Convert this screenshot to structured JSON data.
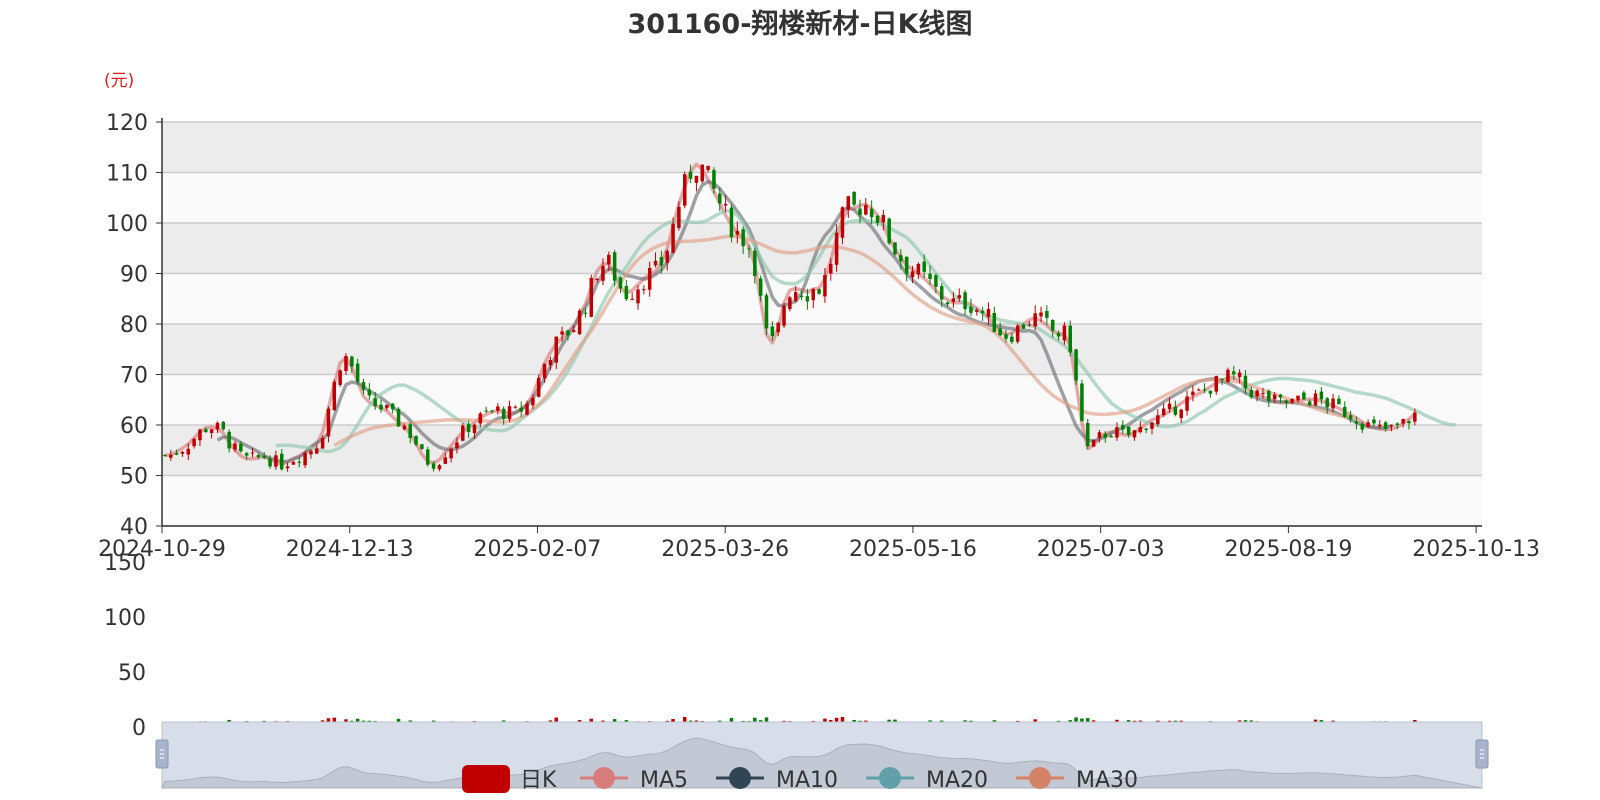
{
  "chart_data": {
    "type": "candlestick",
    "title": "301160-翔楼新材-日K线图",
    "unit_label": "(元)",
    "colors": {
      "up": "#c00000",
      "down": "#008000",
      "ma5": "#d87c7c",
      "ma10": "#6e7074",
      "ma20": "#91c7ae",
      "ma30": "#e0a088",
      "title": "#333333",
      "unit": "#e02020"
    },
    "price_axis": {
      "min": 40,
      "max": 120,
      "ticks": [
        40,
        50,
        60,
        70,
        80,
        90,
        100,
        110,
        120
      ]
    },
    "volume_axis": {
      "min": 0,
      "max": 150,
      "ticks": [
        0,
        50,
        100,
        150
      ]
    },
    "x_tick_labels": [
      {
        "index": 0,
        "label": "2024-10-29"
      },
      {
        "index": 32,
        "label": "2024-12-13"
      },
      {
        "index": 64,
        "label": "2025-02-07"
      },
      {
        "index": 96,
        "label": "2025-03-26"
      },
      {
        "index": 128,
        "label": "2025-05-16"
      },
      {
        "index": 160,
        "label": "2025-07-03"
      },
      {
        "index": 192,
        "label": "2025-08-19"
      },
      {
        "index": 224,
        "label": "2025-10-13"
      }
    ],
    "legend": [
      "日K",
      "MA5",
      "MA10",
      "MA20",
      "MA30"
    ],
    "series": [
      {
        "name": "MA5",
        "color": "#d87c7c",
        "values": [
          54.0,
          54.1,
          54.7,
          55.4,
          56.2,
          57.4,
          58.6,
          59.4,
          59.6,
          59.3,
          58.4,
          56.5,
          55.1,
          53.9,
          53.3,
          53.3,
          53.5,
          53.8,
          53.1,
          52.7,
          52.2,
          52.7,
          53.4,
          53.8,
          54.5,
          55.3,
          56.3,
          58.6,
          63.4,
          68.1,
          72.3,
          73.3,
          71.5,
          68.6,
          65.7,
          64.5,
          63.9,
          63.4,
          62.8,
          61.6,
          60.6,
          59.8,
          58.2,
          56.4,
          54.2,
          52.8,
          52.5,
          53.1,
          54.6,
          55.9,
          57.3,
          58.6,
          59.7,
          60.5,
          61.4,
          62.1,
          62.6,
          62.9,
          62.5,
          62.4,
          62.4,
          63.1,
          64.1,
          66.0,
          69.0,
          72.2,
          74.4,
          76.1,
          77.2,
          78.5,
          79.6,
          81.8,
          84.0,
          87.2,
          90.5,
          91.9,
          91.9,
          89.7,
          87.2,
          86.1,
          86.7,
          87.8,
          89.0,
          89.8,
          90.4,
          92.1,
          95.0,
          99.4,
          103.8,
          107.1,
          110.2,
          111.6,
          110.7,
          108.6,
          106.2,
          103.9,
          101.5,
          99.6,
          98.0,
          97.0,
          95.4,
          91.8,
          84.5,
          77.9,
          76.3,
          79.1,
          84.1,
          86.7,
          87.0,
          86.8,
          86.3,
          86.9,
          87.1,
          89.0,
          92.6,
          97.0,
          100.7,
          102.8,
          102.8,
          103.5,
          103.7,
          102.9,
          101.5,
          99.6,
          97.0,
          94.9,
          93.1,
          91.6,
          90.8,
          90.0,
          89.0,
          87.9,
          86.6,
          85.5,
          84.8,
          84.2,
          84.2,
          84.3,
          83.9,
          83.1,
          82.2,
          81.2,
          79.9,
          78.6,
          77.9,
          78.2,
          79.0,
          80.0,
          80.8,
          81.2,
          80.6,
          79.7,
          78.6,
          78.1,
          77.9,
          75.7,
          68.3,
          60.5,
          55.3,
          56.0,
          57.5,
          58.3,
          58.6,
          58.5,
          58.1,
          58.0,
          58.5,
          59.2,
          60.3,
          61.0,
          61.4,
          62.0,
          62.7,
          63.5,
          64.3,
          65.0,
          65.6,
          66.2,
          66.8,
          67.6,
          68.3,
          68.7,
          69.4,
          69.4,
          68.8,
          67.4,
          66.7,
          66.1,
          65.6,
          65.1,
          64.6,
          64.4,
          64.4,
          64.5,
          64.7,
          65.0,
          65.1,
          65.1,
          64.8,
          64.3,
          63.8,
          63.3,
          62.6,
          62.0,
          61.4,
          60.6,
          59.9,
          59.5,
          59.2,
          59.1,
          59.2,
          59.6,
          60.3,
          61.2,
          62.1
        ]
      },
      {
        "name": "MA10",
        "color": "#6e7074",
        "values": [
          null,
          null,
          null,
          null,
          null,
          null,
          null,
          null,
          null,
          57.0,
          57.6,
          57.6,
          57.2,
          56.5,
          55.9,
          55.3,
          54.7,
          53.9,
          53.4,
          53.1,
          52.7,
          52.8,
          53.2,
          53.7,
          54.6,
          55.7,
          56.5,
          57.2,
          58.4,
          61.8,
          65.1,
          68.0,
          68.5,
          68.3,
          67.6,
          66.7,
          66.1,
          65.4,
          64.5,
          63.6,
          62.7,
          62.0,
          60.9,
          59.7,
          58.4,
          57.3,
          56.3,
          55.6,
          55.2,
          55.1,
          55.4,
          55.8,
          56.6,
          57.5,
          58.7,
          59.8,
          60.7,
          61.3,
          61.5,
          61.8,
          62.5,
          63.1,
          63.9,
          65.3,
          67.1,
          69.2,
          71.6,
          73.7,
          75.8,
          77.6,
          79.5,
          81.4,
          83.3,
          85.3,
          88.0,
          90.0,
          90.9,
          90.9,
          90.3,
          89.6,
          89.4,
          89.1,
          88.9,
          89.1,
          89.8,
          90.7,
          92.2,
          94.1,
          96.4,
          99.1,
          102.1,
          105.4,
          107.5,
          108.2,
          107.8,
          106.8,
          105.3,
          103.9,
          102.3,
          100.6,
          98.8,
          96.0,
          92.2,
          88.6,
          85.3,
          83.7,
          83.6,
          84.1,
          84.5,
          86.1,
          89.1,
          92.6,
          95.6,
          97.5,
          98.8,
          100.6,
          102.4,
          103.1,
          102.6,
          101.4,
          100.4,
          99.2,
          97.6,
          95.8,
          94.4,
          93.1,
          91.5,
          89.9,
          88.7,
          87.7,
          86.7,
          85.6,
          84.7,
          84.0,
          83.3,
          82.5,
          81.9,
          81.6,
          81.0,
          80.5,
          80.1,
          79.9,
          79.6,
          79.5,
          79.2,
          79.1,
          78.8,
          78.6,
          78.7,
          78.3,
          76.9,
          74.1,
          71.1,
          68.2,
          65.3,
          62.6,
          59.8,
          58.2,
          57.0,
          56.8,
          57.2,
          57.7,
          58.4,
          59.0,
          59.4,
          60.1,
          60.9,
          61.7,
          62.4,
          63.0,
          63.8,
          64.6,
          65.3,
          66.0,
          66.6,
          67.3,
          68.0,
          68.6,
          68.9,
          69.1,
          69.1,
          68.7,
          68.3,
          67.7,
          67.0,
          66.4,
          65.8,
          65.3,
          64.9,
          64.7,
          64.6,
          64.6,
          64.6,
          64.5,
          64.3,
          64.1,
          63.8,
          63.6,
          63.4,
          63.1,
          62.7,
          62.2,
          61.7,
          61.1,
          60.5,
          60.0,
          59.6,
          59.5,
          59.4,
          59.5,
          59.8
        ]
      },
      {
        "name": "MA20",
        "color": "#91c7ae",
        "values": [
          null,
          null,
          null,
          null,
          null,
          null,
          null,
          null,
          null,
          null,
          null,
          null,
          null,
          null,
          null,
          null,
          null,
          null,
          null,
          55.9,
          56.0,
          56.0,
          55.9,
          55.7,
          55.6,
          55.4,
          55.2,
          54.9,
          54.7,
          55.0,
          55.5,
          56.6,
          58.2,
          60.1,
          62.0,
          63.8,
          65.2,
          66.1,
          66.9,
          67.5,
          67.9,
          67.9,
          67.4,
          66.9,
          66.2,
          65.4,
          64.6,
          63.7,
          62.9,
          62.0,
          61.2,
          60.6,
          60.0,
          59.6,
          59.4,
          59.2,
          59.0,
          58.9,
          58.9,
          59.3,
          60.1,
          61.1,
          62.0,
          62.9,
          63.8,
          64.8,
          66.0,
          67.3,
          68.9,
          70.7,
          72.8,
          74.9,
          77.1,
          79.3,
          81.8,
          84.2,
          86.3,
          88.1,
          89.8,
          91.3,
          93.1,
          94.8,
          96.3,
          97.5,
          98.4,
          99.3,
          100.0,
          100.3,
          100.4,
          100.3,
          100.2,
          100.1,
          100.2,
          100.6,
          101.3,
          101.9,
          102.4,
          102.3,
          101.5,
          100.0,
          97.7,
          95.4,
          93.1,
          91.1,
          89.4,
          88.6,
          88.1,
          88.0,
          88.0,
          88.7,
          89.7,
          91.3,
          93.2,
          95.2,
          97.1,
          98.6,
          99.7,
          100.2,
          100.4,
          100.5,
          100.5,
          100.3,
          100.0,
          99.6,
          99.0,
          98.4,
          97.8,
          97.1,
          96.0,
          94.6,
          93.1,
          91.6,
          90.1,
          88.6,
          87.2,
          85.8,
          84.7,
          83.9,
          83.3,
          82.8,
          82.2,
          81.6,
          81.2,
          80.8,
          80.6,
          80.4,
          80.2,
          80.0,
          79.8,
          79.4,
          78.8,
          78.0,
          77.2,
          76.6,
          75.7,
          74.7,
          73.3,
          71.7,
          70.2,
          68.6,
          67.1,
          65.7,
          64.4,
          63.5,
          62.8,
          62.2,
          61.6,
          61.1,
          60.6,
          60.2,
          59.9,
          59.7,
          59.7,
          59.9,
          60.3,
          60.7,
          61.4,
          62.2,
          62.8,
          63.6,
          64.4,
          65.2,
          65.8,
          66.3,
          66.9,
          67.4,
          67.9,
          68.3,
          68.6,
          68.9,
          69.1,
          69.2,
          69.2,
          69.1,
          69.0,
          68.9,
          68.8,
          68.6,
          68.3,
          68.0,
          67.7,
          67.4,
          67.1,
          66.8,
          66.5,
          66.3,
          66.1,
          65.9,
          65.6,
          65.3,
          64.9,
          64.4,
          63.9,
          63.4,
          62.9,
          62.4,
          61.8,
          61.3,
          60.8,
          60.4,
          60.1,
          60.0
        ]
      },
      {
        "name": "MA30",
        "color": "#e0a088",
        "values": [
          null,
          null,
          null,
          null,
          null,
          null,
          null,
          null,
          null,
          null,
          null,
          null,
          null,
          null,
          null,
          null,
          null,
          null,
          null,
          null,
          null,
          null,
          null,
          null,
          null,
          null,
          null,
          null,
          null,
          56.0,
          56.6,
          57.2,
          57.8,
          58.3,
          58.8,
          59.2,
          59.5,
          59.7,
          59.9,
          60.0,
          60.1,
          60.3,
          60.4,
          60.5,
          60.6,
          60.7,
          60.8,
          60.9,
          61.0,
          61.0,
          61.0,
          61.0,
          61.0,
          60.9,
          60.9,
          60.8,
          60.7,
          60.6,
          60.6,
          60.7,
          61.0,
          61.5,
          62.2,
          63.1,
          64.1,
          65.3,
          66.8,
          68.5,
          70.3,
          72.0,
          73.8,
          75.5,
          77.1,
          78.7,
          80.5,
          82.4,
          84.4,
          86.3,
          88.1,
          89.9,
          91.5,
          92.8,
          93.8,
          94.6,
          95.2,
          95.7,
          96.1,
          96.2,
          96.3,
          96.4,
          96.4,
          96.5,
          96.6,
          96.7,
          96.9,
          97.1,
          97.3,
          97.4,
          97.3,
          97.1,
          96.7,
          96.3,
          95.8,
          95.3,
          94.8,
          94.4,
          94.2,
          94.1,
          94.1,
          94.3,
          94.5,
          94.8,
          95.1,
          95.3,
          95.4,
          95.3,
          95.1,
          94.8,
          94.5,
          94.1,
          93.5,
          92.8,
          92.0,
          91.1,
          90.1,
          89.1,
          88.0,
          86.9,
          85.9,
          85.0,
          84.2,
          83.4,
          82.8,
          82.2,
          81.7,
          81.3,
          81.0,
          80.7,
          80.4,
          80.2,
          79.8,
          79.2,
          78.4,
          77.4,
          76.2,
          74.8,
          73.4,
          72.0,
          70.6,
          69.3,
          68.0,
          66.9,
          65.9,
          65.1,
          64.4,
          63.8,
          63.3,
          62.8,
          62.4,
          62.2,
          62.1,
          62.1,
          62.2,
          62.3,
          62.5,
          62.7,
          63.0,
          63.4,
          63.9,
          64.5,
          65.1,
          65.7,
          66.3,
          66.9,
          67.5,
          68.0,
          68.4,
          68.7,
          68.9,
          69.0,
          69.0,
          69.0,
          68.9,
          68.7,
          68.5,
          68.2,
          67.8,
          67.4,
          66.9,
          66.5,
          66.1,
          65.7,
          65.3,
          64.9,
          64.5,
          64.1,
          63.7,
          63.3,
          62.9,
          62.5,
          62.2,
          61.9,
          61.6,
          61.4
        ]
      }
    ]
  },
  "legend_items": [
    {
      "label": "日K"
    },
    {
      "label": "MA5"
    },
    {
      "label": "MA10"
    },
    {
      "label": "MA20"
    },
    {
      "label": "MA30"
    }
  ]
}
